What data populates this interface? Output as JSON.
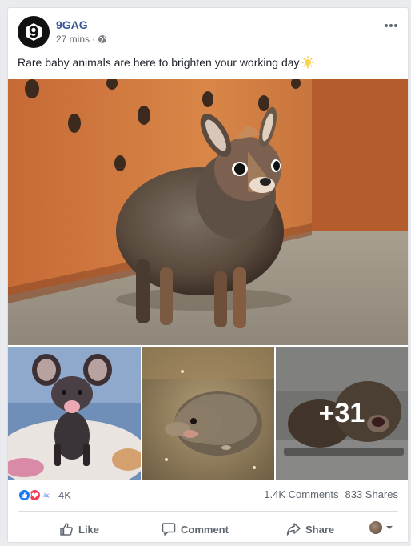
{
  "post": {
    "page_name": "9GAG",
    "timestamp": "27 mins",
    "separator": "·",
    "text": "Rare baby animals are here to brighten your working day",
    "more_photos": "+31"
  },
  "stats": {
    "reaction_count": "4K",
    "comments": "1.4K Comments",
    "shares": "833 Shares"
  },
  "actions": {
    "like": "Like",
    "comment": "Comment",
    "share": "Share"
  },
  "icons": {
    "logo": "9gag-logo-icon",
    "privacy": "globe-icon",
    "more": "more-options-icon",
    "emoji": "sun-emoji-icon"
  },
  "colors": {
    "page_name": "#385898",
    "like_reaction": "#1877f2",
    "love_reaction": "#f33e58"
  }
}
